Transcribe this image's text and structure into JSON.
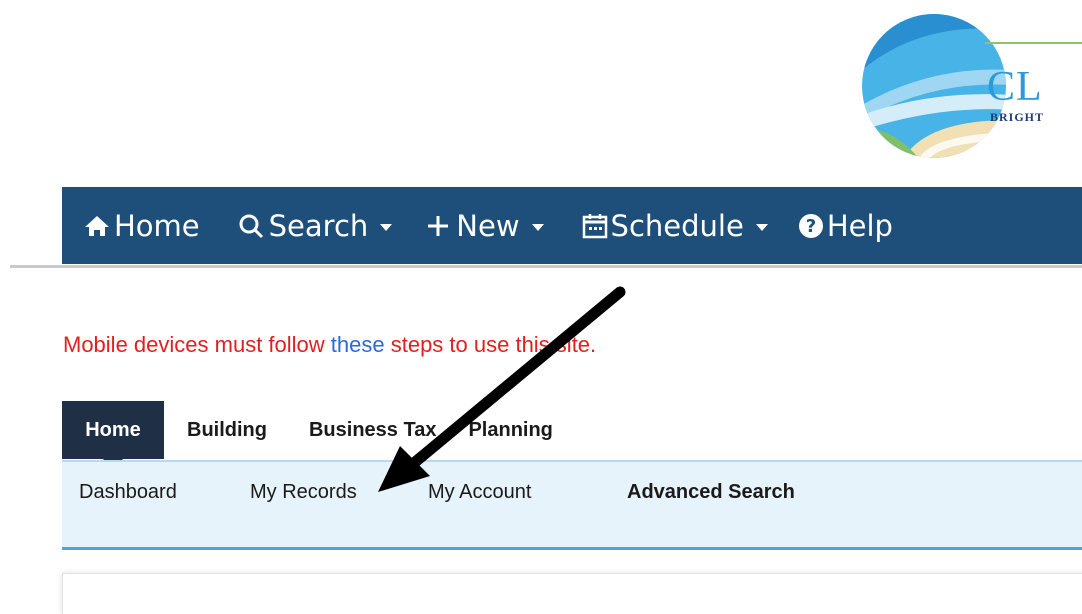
{
  "logo": {
    "text": "CL",
    "subtext": "BRIGHT"
  },
  "top_nav": {
    "items": [
      {
        "label": "Home",
        "icon": "home-icon"
      },
      {
        "label": "Search",
        "icon": "search-icon",
        "dropdown": true
      },
      {
        "label": "New",
        "icon": "plus-icon",
        "dropdown": true
      },
      {
        "label": "Schedule",
        "icon": "calendar-icon",
        "dropdown": true
      },
      {
        "label": "Help",
        "icon": "help-icon"
      }
    ]
  },
  "notice": {
    "before": "Mobile devices must follow ",
    "link": "these",
    "after": " steps to use this site."
  },
  "tabs": [
    {
      "label": "Home",
      "active": true
    },
    {
      "label": "Building",
      "active": false
    },
    {
      "label": "Business Tax",
      "active": false
    },
    {
      "label": "Planning",
      "active": false
    }
  ],
  "subnav": [
    {
      "label": "Dashboard"
    },
    {
      "label": "My Records"
    },
    {
      "label": "My Account"
    },
    {
      "label": "Advanced Search"
    }
  ],
  "colors": {
    "nav_bg": "#1d4f7a",
    "tab_active": "#1f2f45",
    "notice": "#e02020",
    "link": "#2a6ad6",
    "subbar_bg": "#e6f3fb",
    "subbar_border": "#4aa3df"
  },
  "annotation_arrow": "arrow pointing to My Records"
}
